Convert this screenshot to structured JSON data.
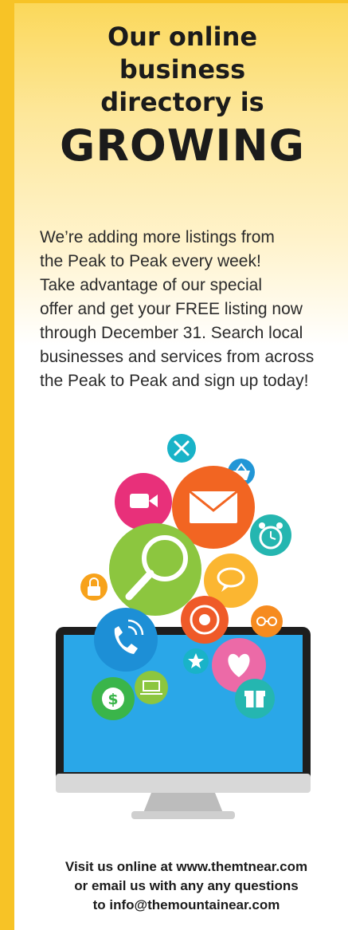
{
  "headline": {
    "line1": "Our online",
    "line2": "business",
    "line3": "directory is",
    "line4": "GROWING"
  },
  "body_lines": [
    "We’re adding more listings from",
    "the Peak to Peak every week!",
    "Take advantage of our special",
    "offer and get your FREE listing now",
    "through December 31. Search local",
    "businesses and services from across",
    "the Peak to Peak and sign up today!"
  ],
  "footer": {
    "line1": "Visit us online at www.themtnear.com",
    "line2": "or email us with any any questions",
    "line3": "to info@themountainear.com"
  },
  "icons": [
    "tools-icon",
    "shopping-basket-icon",
    "video-camera-icon",
    "mail-icon",
    "magnifying-glass-icon",
    "alarm-clock-icon",
    "lock-icon",
    "chat-icon",
    "target-icon",
    "glasses-icon",
    "phone-icon",
    "heart-icon",
    "star-icon",
    "laptop-icon",
    "dollar-icon",
    "gift-icon",
    "monitor-icon"
  ],
  "colors": {
    "border": "#f7c326",
    "headline": "#1b1b1b",
    "screen": "#2aa7e8"
  }
}
